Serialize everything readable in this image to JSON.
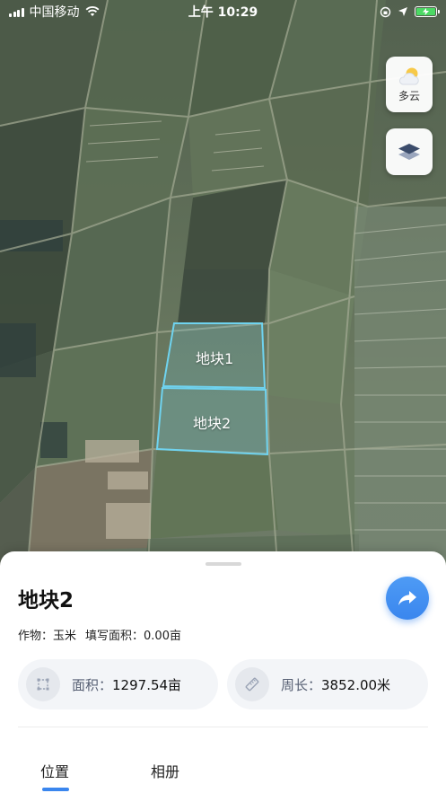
{
  "status_bar": {
    "carrier": "中国移动",
    "time": "上午 10:29",
    "icons": [
      "signal-icon",
      "wifi-icon",
      "orientation-lock-icon",
      "location-arrow-icon",
      "battery-charging-icon"
    ]
  },
  "map": {
    "parcels": [
      {
        "label": "地块1"
      },
      {
        "label": "地块2"
      }
    ],
    "parcel_color": "#6fd3ef"
  },
  "map_controls": {
    "weather_label": "多云",
    "weather_icon": "partly-cloudy-icon",
    "layers_icon": "layers-icon"
  },
  "sheet": {
    "title": "地块2",
    "crop_label": "作物：玉米",
    "filled_area_label": "填写面积：0.00亩",
    "area_key": "面积：",
    "area_value": "1297.54亩",
    "perimeter_key": "周长：",
    "perimeter_value": "3852.00米",
    "tabs": [
      {
        "label": "位置",
        "active": true
      },
      {
        "label": "相册",
        "active": false
      }
    ],
    "accent_color": "#3a86ee"
  }
}
